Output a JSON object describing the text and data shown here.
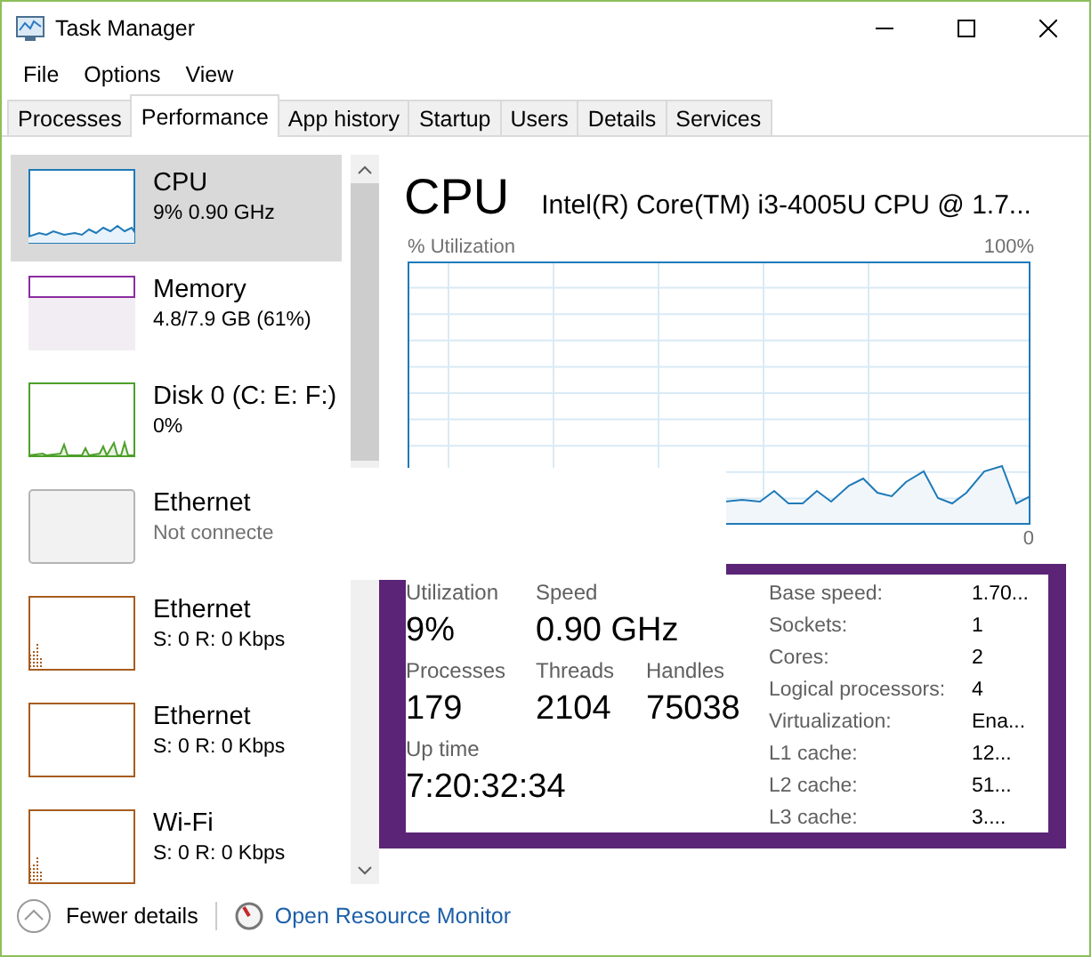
{
  "window": {
    "title": "Task Manager"
  },
  "menu": [
    "File",
    "Options",
    "View"
  ],
  "tabs": [
    {
      "label": "Processes",
      "selected": false
    },
    {
      "label": "Performance",
      "selected": true
    },
    {
      "label": "App history",
      "selected": false
    },
    {
      "label": "Startup",
      "selected": false
    },
    {
      "label": "Users",
      "selected": false
    },
    {
      "label": "Details",
      "selected": false
    },
    {
      "label": "Services",
      "selected": false
    }
  ],
  "sidebar": {
    "items": [
      {
        "name": "CPU",
        "detail": "9% 0.90 GHz",
        "kind": "line",
        "color": "#1f7ab8",
        "selected": true,
        "disabled": false
      },
      {
        "name": "Memory",
        "detail": "4.8/7.9 GB (61%)",
        "kind": "fill",
        "color": "#8b2ca0",
        "selected": false,
        "disabled": false
      },
      {
        "name": "Disk 0 (C: E: F:)",
        "detail": "0%",
        "kind": "spikes",
        "color": "#4da02a",
        "selected": false,
        "disabled": false
      },
      {
        "name": "Ethernet",
        "detail": "Not connecte",
        "kind": "empty",
        "color": "#b4b4b4",
        "selected": false,
        "disabled": true
      },
      {
        "name": "Ethernet",
        "detail": "S: 0 R: 0 Kbps",
        "kind": "bars",
        "color": "#a75c1e",
        "selected": false,
        "disabled": false
      },
      {
        "name": "Ethernet",
        "detail": "S: 0 R: 0 Kbps",
        "kind": "empty",
        "color": "#a75c1e",
        "selected": false,
        "disabled": false
      },
      {
        "name": "Wi-Fi",
        "detail": "S: 0 R: 0 Kbps",
        "kind": "bars",
        "color": "#a75c1e",
        "selected": false,
        "disabled": false
      }
    ]
  },
  "detail": {
    "title": "CPU",
    "model": "Intel(R) Core(TM) i3-4005U CPU @ 1.7...",
    "graph_label": "% Utilization",
    "graph_max": "100%",
    "graph_min": "0",
    "stats": [
      {
        "label": "Utilization",
        "value": "9%"
      },
      {
        "label": "Speed",
        "value": "0.90 GHz"
      },
      {
        "label": "Processes",
        "value": "179"
      },
      {
        "label": "Threads",
        "value": "2104"
      },
      {
        "label": "Handles",
        "value": "75038"
      },
      {
        "label": "Up time",
        "value": "7:20:32:34"
      }
    ],
    "specs": [
      {
        "label": "Base speed:",
        "value": "1.70..."
      },
      {
        "label": "Sockets:",
        "value": "1"
      },
      {
        "label": "Cores:",
        "value": "2"
      },
      {
        "label": "Logical processors:",
        "value": "4"
      },
      {
        "label": "Virtualization:",
        "value": "Ena..."
      },
      {
        "label": "L1 cache:",
        "value": "12..."
      },
      {
        "label": "L2 cache:",
        "value": "51..."
      },
      {
        "label": "L3 cache:",
        "value": "3...."
      }
    ]
  },
  "footer": {
    "fewer": "Fewer details",
    "monitor": "Open Resource Monitor"
  }
}
